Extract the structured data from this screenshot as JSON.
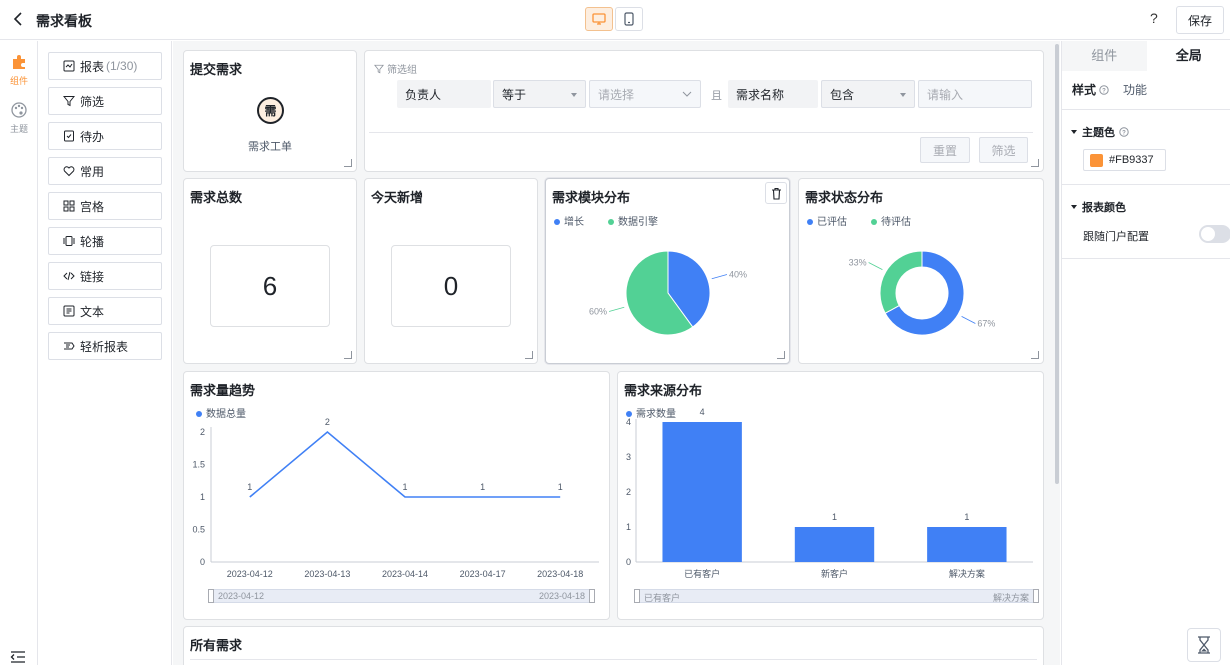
{
  "header": {
    "title": "需求看板",
    "save_label": "保存",
    "help_glyph": "?"
  },
  "rail": {
    "items": [
      {
        "label": "组件",
        "icon": "puzzle-icon",
        "active": true
      },
      {
        "label": "主题",
        "icon": "palette-icon",
        "active": false
      }
    ]
  },
  "components": {
    "items": [
      {
        "label": "报表",
        "count": "(1/30)",
        "icon": "report-icon"
      },
      {
        "label": "筛选",
        "icon": "filter-icon"
      },
      {
        "label": "待办",
        "icon": "todo-icon"
      },
      {
        "label": "常用",
        "icon": "heart-icon"
      },
      {
        "label": "宫格",
        "icon": "grid-icon"
      },
      {
        "label": "轮播",
        "icon": "carousel-icon"
      },
      {
        "label": "链接",
        "icon": "link-icon"
      },
      {
        "label": "文本",
        "icon": "text-icon"
      },
      {
        "label": "轻析报表",
        "icon": "analysis-icon"
      }
    ]
  },
  "submit_card": {
    "title": "提交需求",
    "icon_char": "需",
    "item_label": "需求工单"
  },
  "filter_card": {
    "group_label": "筛选组",
    "row": {
      "field1": "负责人",
      "op1": "等于",
      "value1_placeholder": "请选择",
      "conj": "且",
      "field2": "需求名称",
      "op2": "包含",
      "value2_placeholder": "请输入"
    },
    "reset_label": "重置",
    "filter_label": "筛选"
  },
  "total_card": {
    "title": "需求总数",
    "value": "6"
  },
  "new_card": {
    "title": "今天新增",
    "value": "0"
  },
  "colors": {
    "accent": "#FB9337",
    "blue": "#4080F5",
    "green": "#52D195"
  },
  "module_card": {
    "title": "需求模块分布",
    "legend": [
      "增长",
      "数据引擎"
    ],
    "labels": [
      "40%",
      "60%"
    ]
  },
  "status_card": {
    "title": "需求状态分布",
    "legend": [
      "已评估",
      "待评估"
    ],
    "labels": [
      "67%",
      "33%"
    ]
  },
  "trend_card": {
    "title": "需求量趋势",
    "legend": "数据总量",
    "slider_start": "2023-04-12",
    "slider_end": "2023-04-18"
  },
  "source_card": {
    "title": "需求来源分布",
    "legend": "需求数量",
    "slider_start": "已有客户",
    "slider_end": "解决方案"
  },
  "all_card": {
    "title": "所有需求"
  },
  "right_panel": {
    "tab_components": "组件",
    "tab_global": "全局",
    "sub_style": "样式",
    "sub_function": "功能",
    "theme_label": "主题色",
    "theme_value": "#FB9337",
    "report_color_label": "报表颜色",
    "follow_label": "跟随门户配置"
  },
  "chart_data": [
    {
      "type": "pie",
      "title": "需求模块分布",
      "categories": [
        "增长",
        "数据引擎"
      ],
      "values": [
        40,
        60
      ],
      "legend_position": "top-left"
    },
    {
      "type": "pie",
      "title": "需求状态分布",
      "categories": [
        "已评估",
        "待评估"
      ],
      "values": [
        67,
        33
      ],
      "donut": true,
      "legend_position": "top-left"
    },
    {
      "type": "line",
      "title": "需求量趋势",
      "categories": [
        "2023-04-12",
        "2023-04-13",
        "2023-04-14",
        "2023-04-17",
        "2023-04-18"
      ],
      "series": [
        {
          "name": "数据总量",
          "values": [
            1,
            2,
            1,
            1,
            1
          ]
        }
      ],
      "yticks": [
        "0",
        "0.5",
        "1",
        "1.5",
        "2"
      ],
      "ylim": [
        0,
        2
      ],
      "grid": false,
      "legend_position": "top-left"
    },
    {
      "type": "bar",
      "title": "需求来源分布",
      "categories": [
        "已有客户",
        "新客户",
        "解决方案"
      ],
      "series": [
        {
          "name": "需求数量",
          "values": [
            4,
            1,
            1
          ]
        }
      ],
      "yticks": [
        "0",
        "1",
        "2",
        "3",
        "4"
      ],
      "ylim": [
        0,
        4
      ],
      "legend_position": "top-left"
    }
  ]
}
